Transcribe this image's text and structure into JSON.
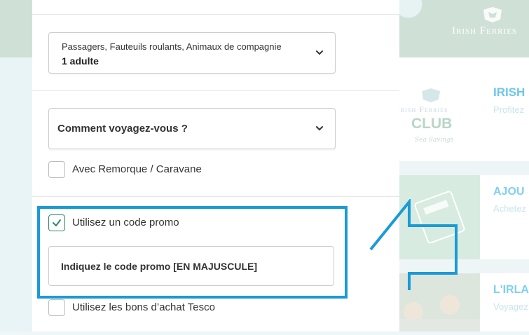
{
  "background": {
    "brand_name": "Irish Ferries",
    "club_card": {
      "logo_text": "Irish Ferries",
      "club_word": "CLUB",
      "signature": "Sea Savings",
      "title": "IRISH",
      "subtitle": "Profitez"
    },
    "flexi_card": {
      "title": "AJOU",
      "subtitle": "Achetez"
    },
    "irl_card": {
      "title": "L'IRLA",
      "subtitle": "Voyagez"
    }
  },
  "form": {
    "passengers": {
      "label": "Passagers, Fauteuils roulants, Animaux de compagnie",
      "value": "1 adulte"
    },
    "travel_mode": {
      "label": "Comment voyagez-vous ?"
    },
    "trailer_checkbox": {
      "label": "Avec Remorque / Caravane",
      "checked": false
    },
    "promo_checkbox": {
      "label": "Utilisez un code promo",
      "checked": true
    },
    "promo_input": {
      "placeholder": "Indiquez le code promo [EN MAJUSCULE]"
    },
    "tesco_checkbox": {
      "label": "Utilisez les bons d’achat Tesco",
      "checked": false
    }
  },
  "colors": {
    "highlight": "#1a9ad6",
    "check": "#2b8a6a",
    "brand_band": "#cfe1d7"
  }
}
